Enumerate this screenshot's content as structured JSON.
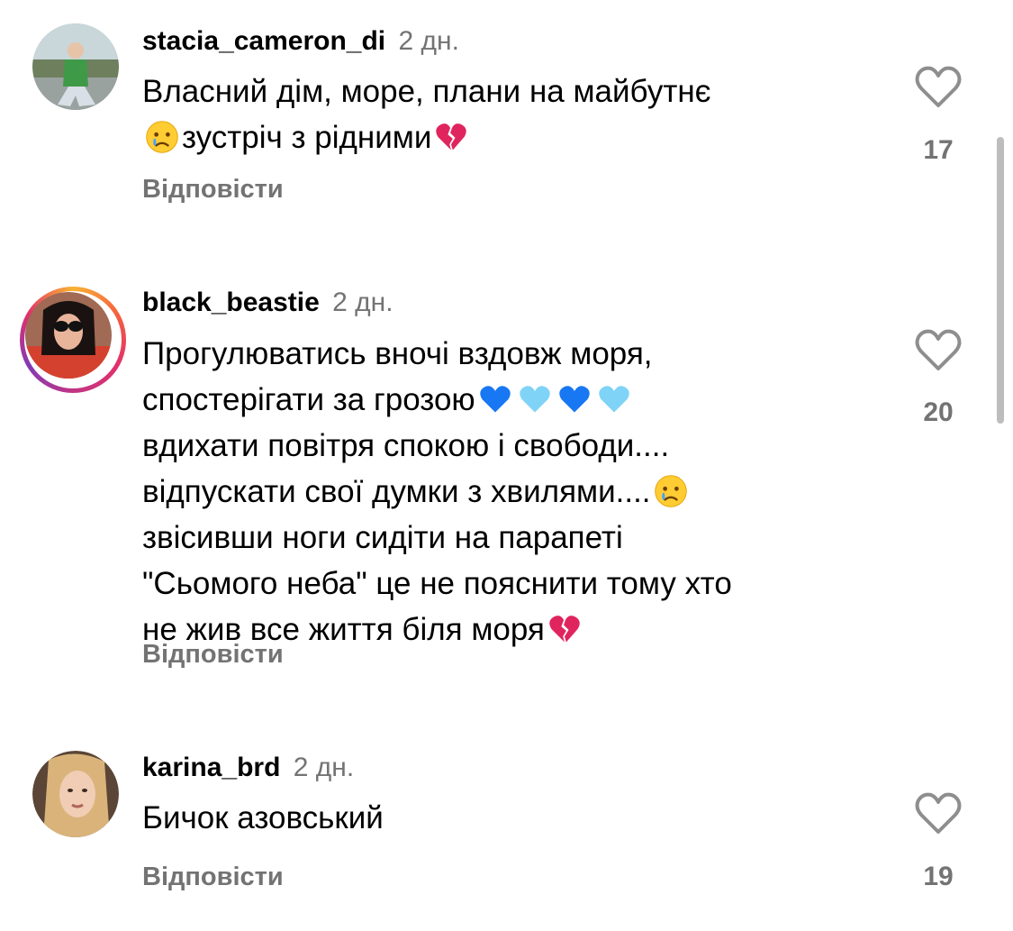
{
  "comments": [
    {
      "username": "stacia_cameron_di",
      "time": "2 дн.",
      "text_parts": [
        "Власний дім, море, плани на майбутнє",
        "зустріч з рідними"
      ],
      "reply_label": "Відповісти",
      "likes": "17"
    },
    {
      "username": "black_beastie",
      "time": "2 дн.",
      "text_parts": [
        "Прогулюватись вночі вздовж моря,",
        "спостерігати за грозою",
        "вдихати повітря спокою і свободи....",
        "відпускати свої думки з хвилями....",
        "звісивши ноги сидіти на парапеті",
        "\"Сьомого неба\" це не пояснити тому хто",
        "не жив все життя біля моря"
      ],
      "reply_label": "Відповісти",
      "likes": "20",
      "has_story_ring": true
    },
    {
      "username": "karina_brd",
      "time": "2 дн.",
      "text_parts": [
        "Бичок азовський"
      ],
      "reply_label": "Відповісти",
      "likes": "19"
    }
  ],
  "icons": {
    "heart": "heart-outline-icon",
    "emoji_crying": "crying-face-emoji",
    "emoji_broken_heart": "broken-heart-emoji",
    "emoji_blue_heart": "blue-heart-emoji",
    "emoji_light_blue_heart": "light-blue-heart-emoji"
  },
  "colors": {
    "secondary_text": "#737373",
    "blue_heart": "#1877f2",
    "light_blue_heart": "#7fd3f7",
    "broken_heart": "#e0245e",
    "story_ring": "#e1306c"
  }
}
